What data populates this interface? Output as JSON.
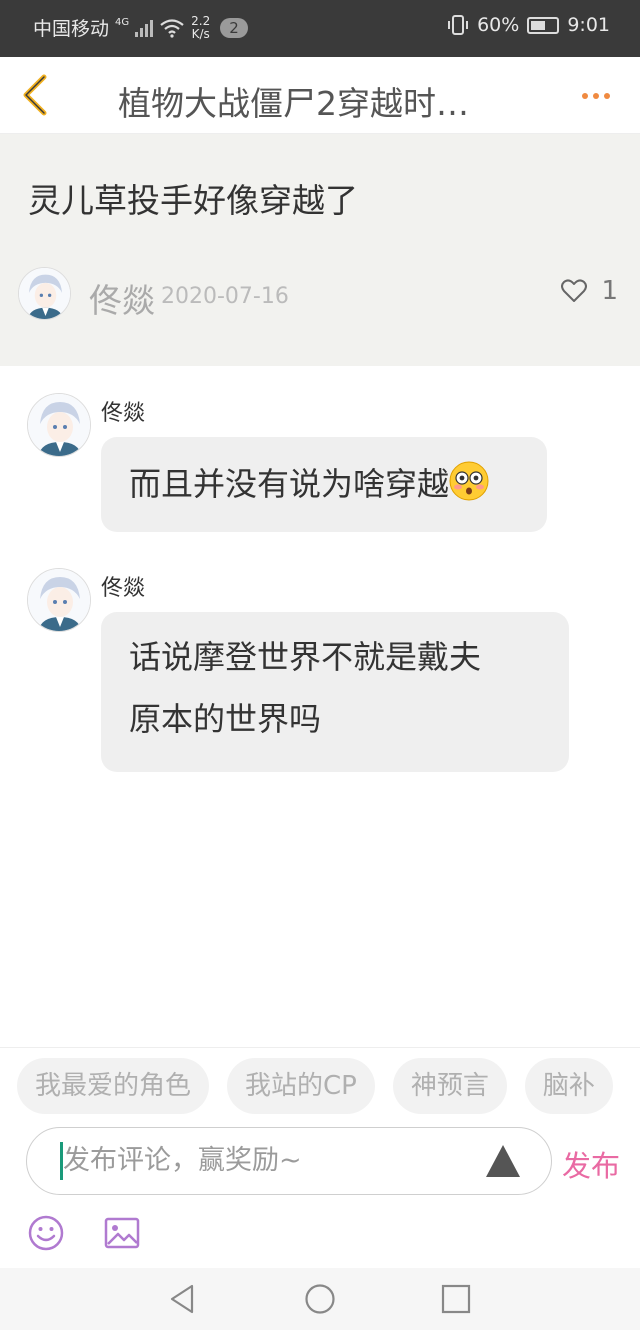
{
  "status_bar": {
    "carrier": "中国移动",
    "network": "4G",
    "speed_value": "2.2",
    "speed_unit": "K/s",
    "notification_count": "2",
    "battery": "60%",
    "battery_level": 0.6,
    "time": "9:01"
  },
  "header": {
    "title": "植物大战僵尸2穿越时…"
  },
  "post": {
    "title": "灵儿草投手好像穿越了",
    "author": "佟燚",
    "date": "2020-07-16",
    "likes": "1"
  },
  "comments": [
    {
      "author": "佟燚",
      "lines": [
        "而且并没有说为啥穿越"
      ],
      "emoji": "flushed-face"
    },
    {
      "author": "佟燚",
      "lines": [
        "话说摩登世界不就是戴夫",
        "原本的世界吗"
      ]
    }
  ],
  "tags": [
    "我最爱的角色",
    "我站的CP",
    "神预言",
    "脑补"
  ],
  "composer": {
    "placeholder": "发布评论，赢奖励~",
    "publish_label": "发布"
  },
  "colors": {
    "accent": "#e96aa3",
    "back_arrow": "#f0b020",
    "more_dots": "#f08a40",
    "icon_purple": "#b07ad0"
  }
}
